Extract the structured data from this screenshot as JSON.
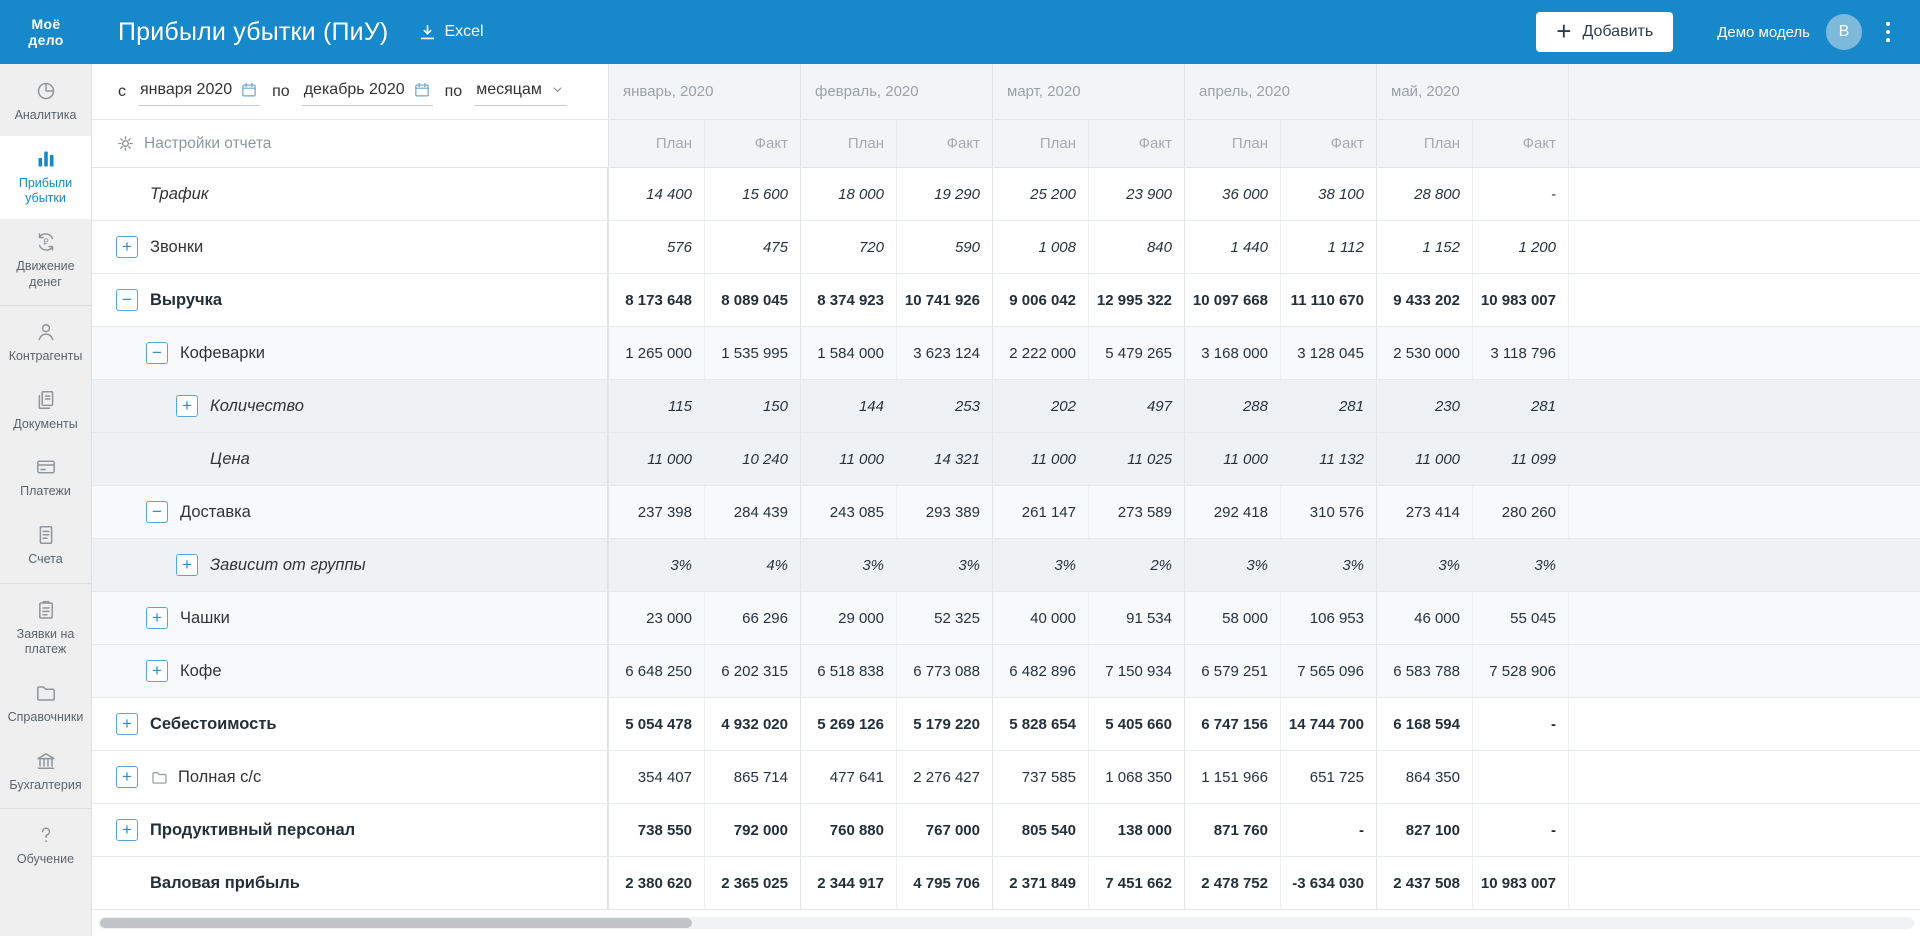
{
  "header": {
    "logo_line1": "Моё",
    "logo_line2": "дело",
    "title": "Прибыли убытки (ПиУ)",
    "excel_label": "Excel",
    "add_button": "Добавить",
    "add_plus": "+",
    "account_label": "Демо модель",
    "avatar_initial": "B"
  },
  "sidebar": {
    "items": [
      {
        "label": "Аналитика",
        "icon": "analytics",
        "active": false,
        "divider_after": false
      },
      {
        "label": "Прибыли убытки",
        "icon": "profit-loss",
        "active": true,
        "divider_after": false
      },
      {
        "label": "Движение денег",
        "icon": "cash-flow",
        "active": false,
        "divider_after": true
      },
      {
        "label": "Контрагенты",
        "icon": "contractors",
        "active": false,
        "divider_after": false
      },
      {
        "label": "Документы",
        "icon": "documents",
        "active": false,
        "divider_after": false
      },
      {
        "label": "Платежи",
        "icon": "payments",
        "active": false,
        "divider_after": false
      },
      {
        "label": "Счета",
        "icon": "invoices",
        "active": false,
        "divider_after": true
      },
      {
        "label": "Заявки на платеж",
        "icon": "payment-requests",
        "active": false,
        "divider_after": false
      },
      {
        "label": "Справочники",
        "icon": "directories",
        "active": false,
        "divider_after": false
      },
      {
        "label": "Бухгалтерия",
        "icon": "accounting",
        "active": false,
        "divider_after": true
      },
      {
        "label": "Обучение",
        "icon": "education",
        "active": false,
        "divider_after": false
      }
    ]
  },
  "filters": {
    "from_label": "с",
    "from_value": "января 2020",
    "to_label": "по",
    "to_value": "декабрь 2020",
    "period_label": "по",
    "period_value": "месяцам",
    "settings_label": "Настройки отчета"
  },
  "report": {
    "months": [
      "январь, 2020",
      "февраль, 2020",
      "март, 2020",
      "апрель, 2020",
      "май, 2020"
    ],
    "plan_label": "План",
    "fact_label": "Факт",
    "rows": [
      {
        "label": "Трафик",
        "level": 0,
        "expand": "",
        "bold": false,
        "italic_label": true,
        "italic_values": true,
        "folder": false,
        "values": [
          "14 400",
          "15 600",
          "18 000",
          "19 290",
          "25 200",
          "23 900",
          "36 000",
          "38 100",
          "28 800",
          "-"
        ]
      },
      {
        "label": "Звонки",
        "level": 0,
        "expand": "plus",
        "bold": false,
        "italic_label": false,
        "italic_values": true,
        "folder": false,
        "values": [
          "576",
          "475",
          "720",
          "590",
          "1 008",
          "840",
          "1 440",
          "1 112",
          "1 152",
          "1 200"
        ]
      },
      {
        "label": "Выручка",
        "level": 0,
        "expand": "minus",
        "bold": true,
        "italic_label": false,
        "italic_values": false,
        "folder": false,
        "values": [
          "8 173 648",
          "8 089 045",
          "8 374 923",
          "10 741 926",
          "9 006 042",
          "12 995 322",
          "10 097 668",
          "11 110 670",
          "9 433 202",
          "10 983 007"
        ]
      },
      {
        "label": "Кофеварки",
        "level": 1,
        "expand": "minus",
        "bold": false,
        "italic_label": false,
        "italic_values": false,
        "folder": false,
        "values": [
          "1 265 000",
          "1 535 995",
          "1 584 000",
          "3 623 124",
          "2 222 000",
          "5 479 265",
          "3 168 000",
          "3 128 045",
          "2 530 000",
          "3 118 796"
        ]
      },
      {
        "label": "Количество",
        "level": 2,
        "expand": "plus",
        "bold": false,
        "italic_label": true,
        "italic_values": true,
        "folder": false,
        "values": [
          "115",
          "150",
          "144",
          "253",
          "202",
          "497",
          "288",
          "281",
          "230",
          "281"
        ]
      },
      {
        "label": "Цена",
        "level": 2,
        "expand": "",
        "bold": false,
        "italic_label": true,
        "italic_values": true,
        "folder": false,
        "values": [
          "11 000",
          "10 240",
          "11 000",
          "14 321",
          "11 000",
          "11 025",
          "11 000",
          "11 132",
          "11 000",
          "11 099"
        ]
      },
      {
        "label": "Доставка",
        "level": 1,
        "expand": "minus",
        "bold": false,
        "italic_label": false,
        "italic_values": false,
        "folder": false,
        "values": [
          "237 398",
          "284 439",
          "243 085",
          "293 389",
          "261 147",
          "273 589",
          "292 418",
          "310 576",
          "273 414",
          "280 260"
        ]
      },
      {
        "label": "Зависит от группы",
        "level": 2,
        "expand": "plus",
        "bold": false,
        "italic_label": true,
        "italic_values": true,
        "folder": false,
        "values": [
          "3%",
          "4%",
          "3%",
          "3%",
          "3%",
          "2%",
          "3%",
          "3%",
          "3%",
          "3%"
        ]
      },
      {
        "label": "Чашки",
        "level": 1,
        "expand": "plus",
        "bold": false,
        "italic_label": false,
        "italic_values": false,
        "folder": false,
        "values": [
          "23 000",
          "66 296",
          "29 000",
          "52 325",
          "40 000",
          "91 534",
          "58 000",
          "106 953",
          "46 000",
          "55 045"
        ]
      },
      {
        "label": "Кофе",
        "level": 1,
        "expand": "plus",
        "bold": false,
        "italic_label": false,
        "italic_values": false,
        "folder": false,
        "values": [
          "6 648 250",
          "6 202 315",
          "6 518 838",
          "6 773 088",
          "6 482 896",
          "7 150 934",
          "6 579 251",
          "7 565 096",
          "6 583 788",
          "7 528 906"
        ]
      },
      {
        "label": "Себестоимость",
        "level": 0,
        "expand": "plus",
        "bold": true,
        "italic_label": false,
        "italic_values": false,
        "folder": false,
        "values": [
          "5 054 478",
          "4 932 020",
          "5 269 126",
          "5 179 220",
          "5 828 654",
          "5 405 660",
          "6 747 156",
          "14 744 700",
          "6 168 594",
          "-"
        ]
      },
      {
        "label": "Полная с/с",
        "level": 0,
        "expand": "plus",
        "bold": false,
        "italic_label": false,
        "italic_values": false,
        "folder": true,
        "values": [
          "354 407",
          "865 714",
          "477 641",
          "2 276 427",
          "737 585",
          "1 068 350",
          "1 151 966",
          "651 725",
          "864 350",
          ""
        ]
      },
      {
        "label": "Продуктивный персонал",
        "level": 0,
        "expand": "plus",
        "bold": true,
        "italic_label": false,
        "italic_values": false,
        "folder": false,
        "values": [
          "738 550",
          "792 000",
          "760 880",
          "767 000",
          "805 540",
          "138 000",
          "871 760",
          "-",
          "827 100",
          "-"
        ]
      },
      {
        "label": "Валовая прибыль",
        "level": 0,
        "expand": "",
        "bold": true,
        "italic_label": false,
        "italic_values": false,
        "folder": false,
        "values": [
          "2 380 620",
          "2 365 025",
          "2 344 917",
          "4 795 706",
          "2 371 849",
          "7 451 662",
          "2 478 752",
          "-3 634 030",
          "2 437 508",
          "10 983 007"
        ]
      }
    ]
  }
}
